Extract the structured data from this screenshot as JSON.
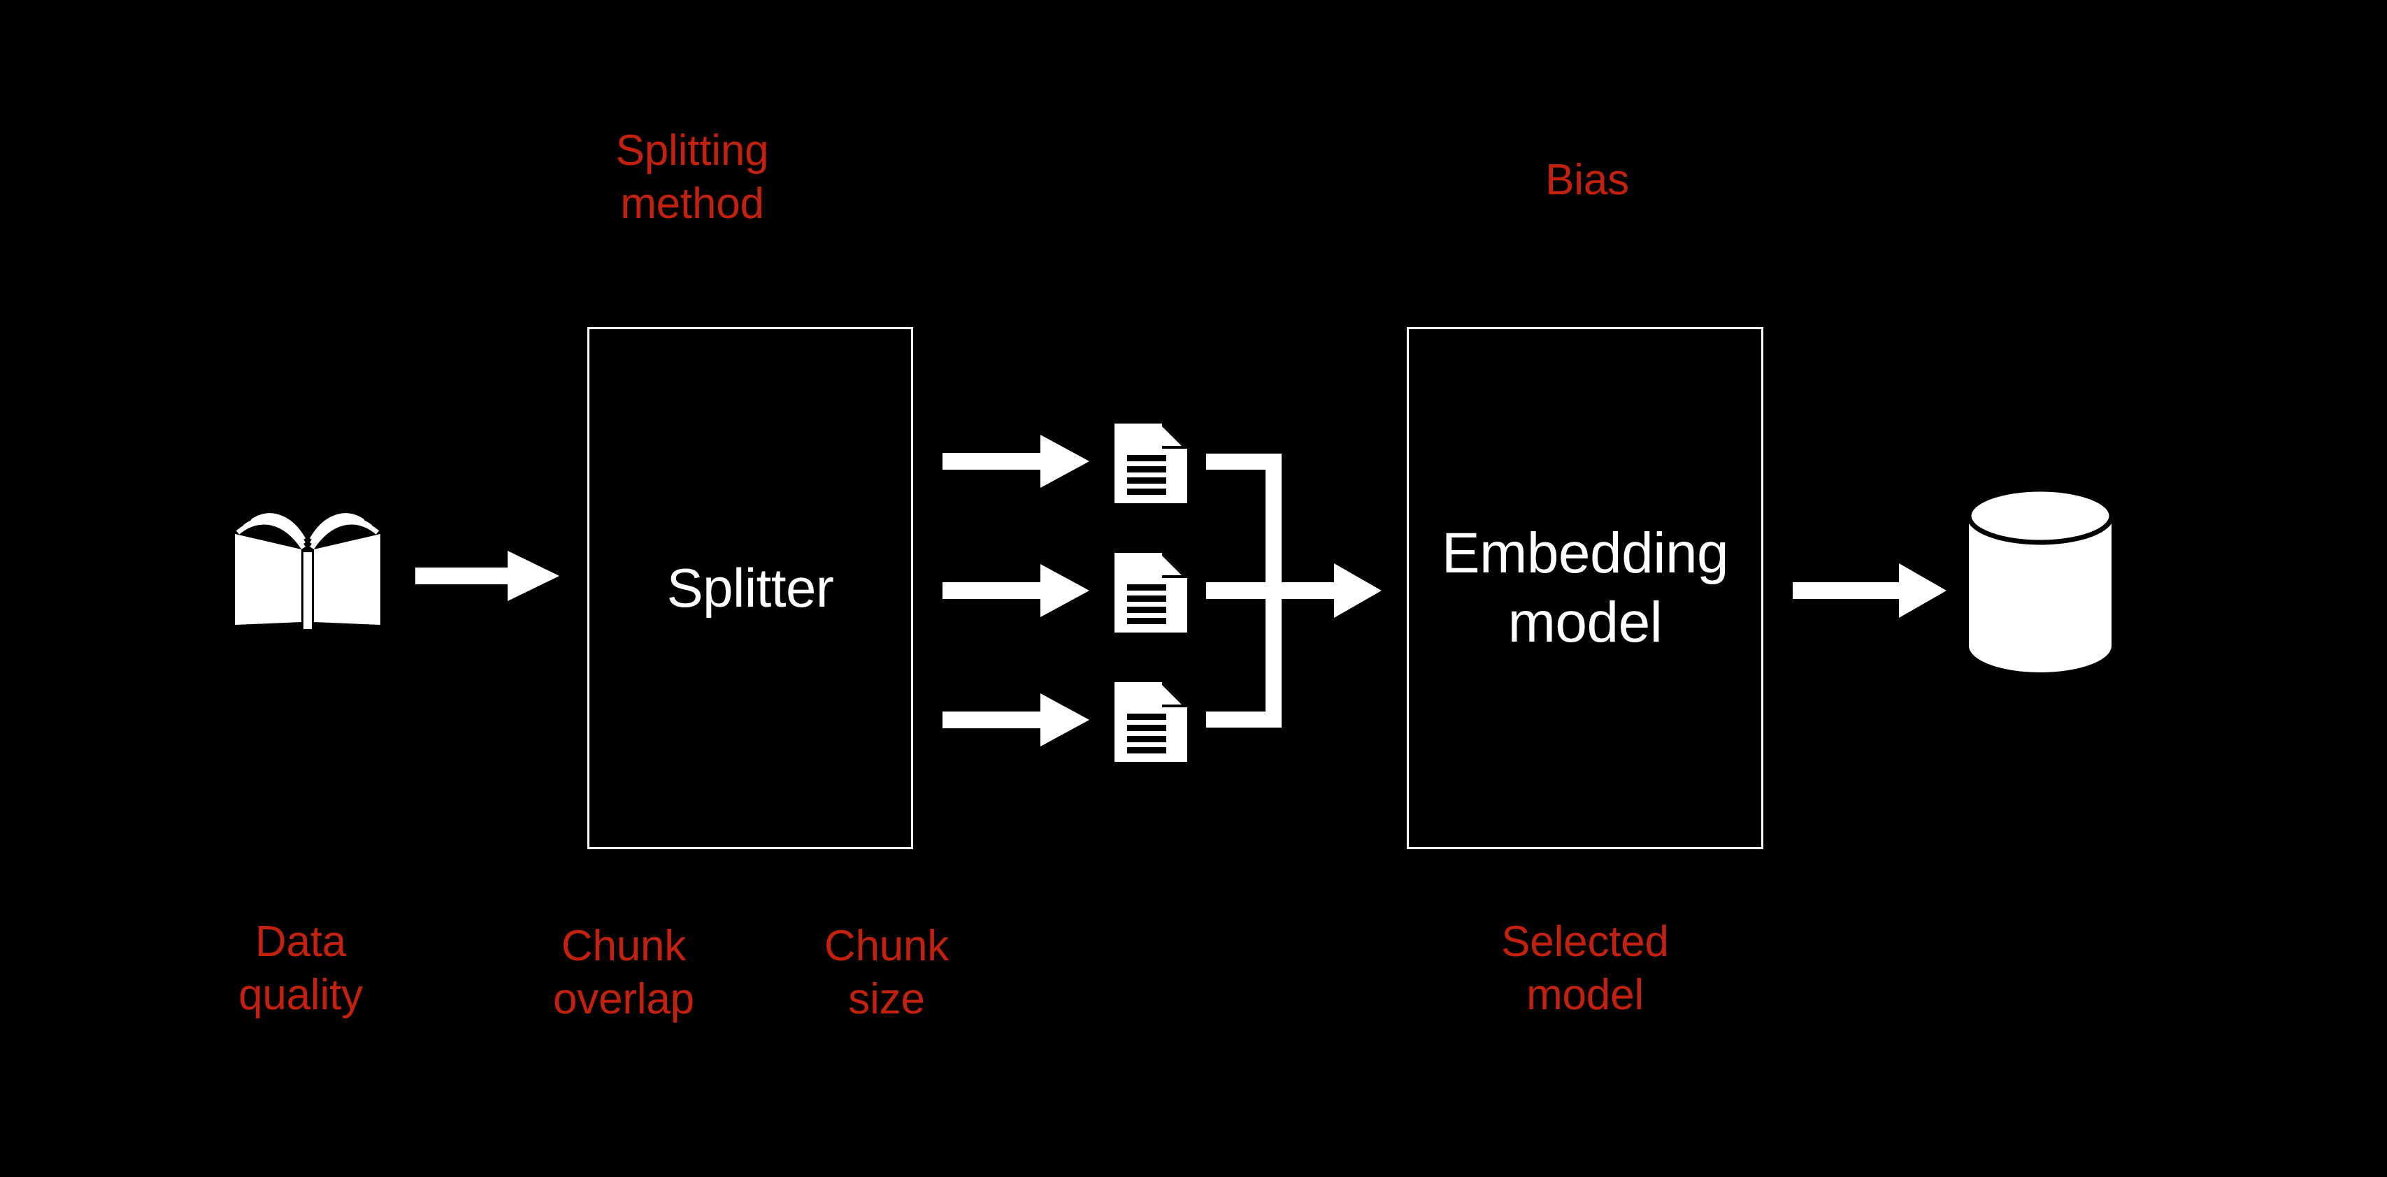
{
  "diagram": {
    "title_context": "RAG ingestion pipeline",
    "background_color": "#000000",
    "accent_color": "#c4200e",
    "foreground_color": "#ffffff"
  },
  "annotations": {
    "splitting_method": "Splitting\nmethod",
    "bias": "Bias",
    "data_quality": "Data\nquality",
    "chunk_overlap": "Chunk\noverlap",
    "chunk_size": "Chunk\nsize",
    "selected_model": "Selected\nmodel"
  },
  "nodes": {
    "source": {
      "icon": "open-book-icon",
      "label": ""
    },
    "splitter": {
      "label": "Splitter"
    },
    "chunks": [
      {
        "icon": "document-icon"
      },
      {
        "icon": "document-icon"
      },
      {
        "icon": "document-icon"
      }
    ],
    "embedding": {
      "label": "Embedding\nmodel"
    },
    "vector_store": {
      "icon": "database-cylinder-icon",
      "label": ""
    }
  },
  "connectors": {
    "book_to_splitter": "arrow-right",
    "splitter_to_chunk_1": "arrow-right",
    "splitter_to_chunk_2": "arrow-right",
    "splitter_to_chunk_3": "arrow-right",
    "chunks_to_embedding": "merge-arrow-right",
    "embedding_to_store": "arrow-right"
  }
}
